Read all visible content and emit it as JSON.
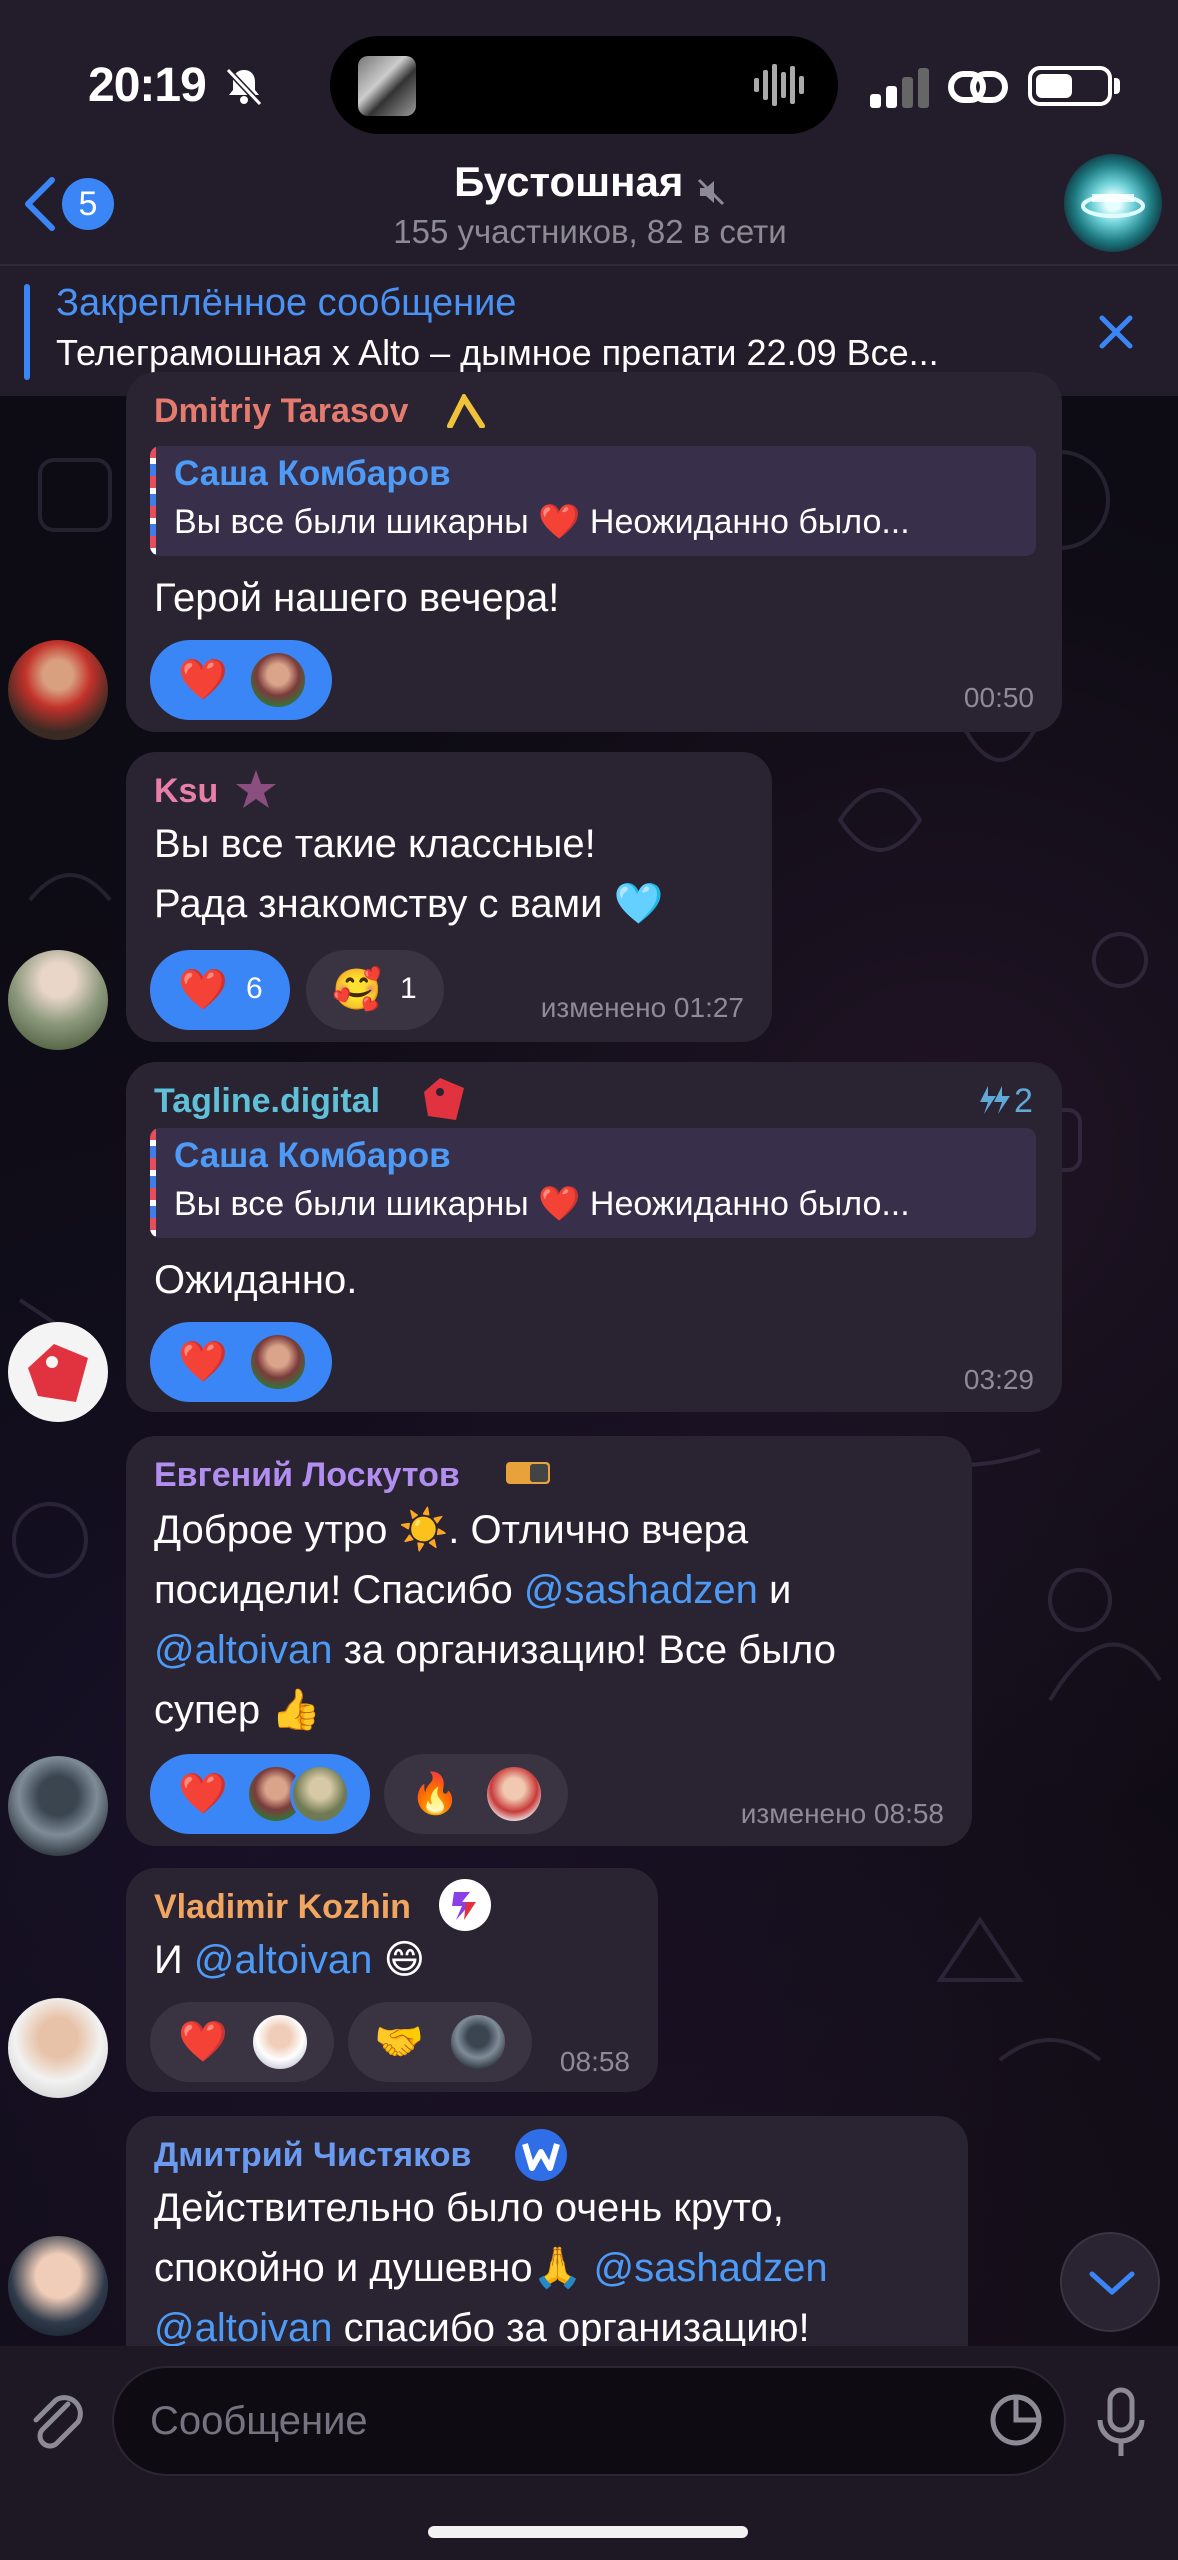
{
  "status_bar": {
    "time": "20:19"
  },
  "header": {
    "back_badge": "5",
    "title": "Бустошная",
    "subtitle": "155 участников, 82 в сети"
  },
  "pinned": {
    "label": "Закреплённое сообщение",
    "text": "Телеграмошная x Alto – дымное препати 22.09 Все..."
  },
  "messages": [
    {
      "sender": "Dmitriy Tarasov",
      "sender_color": "#e57b6f",
      "reply": {
        "name": "Саша Комбаров",
        "text": "Вы все были шикарны ❤️ Неожиданно было..."
      },
      "text_lines": [
        "Герой нашего вечера!"
      ],
      "reactions": [
        {
          "emoji": "❤️"
        }
      ],
      "time": "00:50"
    },
    {
      "sender": "Ksu",
      "sender_color": "#e77fa8",
      "text_lines": [
        "Вы все такие классные!",
        "Рада знакомству с вами 🩵"
      ],
      "reactions": [
        {
          "emoji": "❤️",
          "count": "6"
        },
        {
          "emoji": "🥰",
          "count": "1"
        }
      ],
      "time": "изменено 01:27"
    },
    {
      "sender": "Tagline.digital",
      "sender_color": "#5fc0d8",
      "boost_count": "2",
      "reply": {
        "name": "Саша Комбаров",
        "text": "Вы все были шикарны ❤️ Неожиданно было..."
      },
      "text_lines": [
        "Ожиданно."
      ],
      "reactions": [
        {
          "emoji": "❤️"
        }
      ],
      "time": "03:29"
    },
    {
      "sender": "Евгений Лоскутов",
      "sender_color": "#b18ef0",
      "text_parts": {
        "line1": "Доброе утро ☀️. Отлично вчера",
        "line2_a": "посидели! Спасибо ",
        "line2_mention": "@sashadzen",
        "line2_b": " и",
        "line3_mention": "@altoivan",
        "line3_b": " за организацию! Все было",
        "line4": "супер 👍"
      },
      "reactions": [
        {
          "emoji": "❤️"
        },
        {
          "emoji": "🔥"
        }
      ],
      "time": "изменено 08:58"
    },
    {
      "sender": "Vladimir Kozhin",
      "sender_color": "#f0a560",
      "text_parts": {
        "a": "И ",
        "mention": "@altoivan",
        "b": " 😄"
      },
      "reactions": [
        {
          "emoji": "❤️"
        },
        {
          "emoji": "🤝"
        }
      ],
      "time": "08:58"
    },
    {
      "sender": "Дмитрий Чистяков",
      "sender_color": "#6a9bf0",
      "text_parts": {
        "line1": "Действительно было очень круто,",
        "line2_a": "спокойно и душевно🙏 ",
        "line2_mention": "@sashadzen",
        "line3_mention": "@altoivan",
        "line3_b": " спасибо за организацию!"
      }
    }
  ],
  "input": {
    "placeholder": "Сообщение"
  },
  "colors": {
    "accent": "#3b86f7",
    "bubble": "#2a2432",
    "mention": "#4d9bf6"
  }
}
